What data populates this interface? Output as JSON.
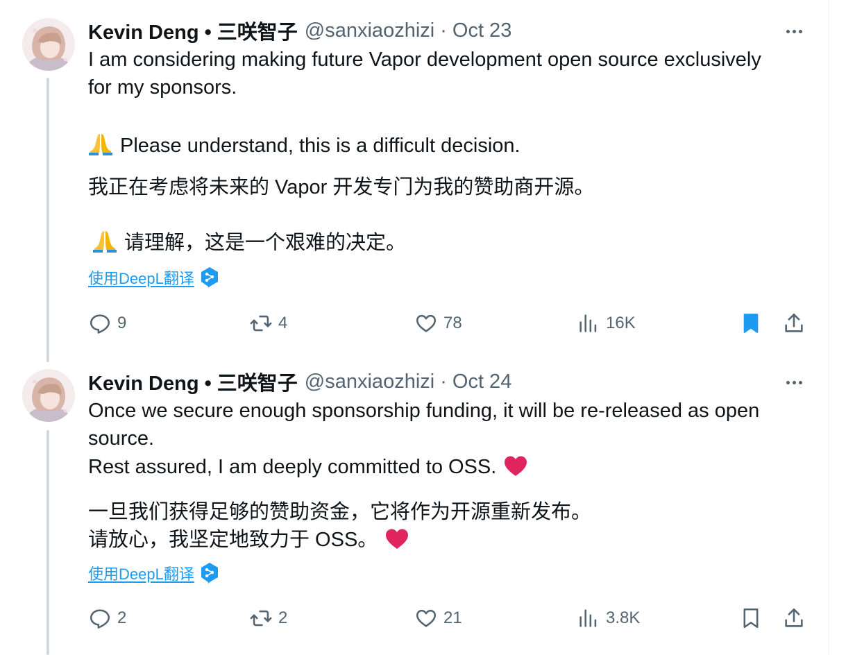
{
  "tweets": [
    {
      "author": {
        "name": "Kevin Deng • 三咲智子",
        "handle": "@sanxiaozhizi",
        "date": "Oct 23"
      },
      "lines": [
        "I am considering making future Vapor development open source exclusively",
        "for my sponsors.",
        "Please understand, this is a difficult decision.",
        "我正在考虑将未来的 Vapor 开发专门为我的赞助商开源。",
        "请理解，这是一个艰难的决定。"
      ],
      "emoji": "🙏",
      "translate_label": "使用DeepL翻译",
      "stats": {
        "replies": "9",
        "retweets": "4",
        "likes": "78",
        "views": "16K"
      },
      "bookmarked": true
    },
    {
      "author": {
        "name": "Kevin Deng • 三咲智子",
        "handle": "@sanxiaozhizi",
        "date": "Oct 24"
      },
      "lines": [
        "Once we secure enough sponsorship funding, it will be re-released as open",
        "source.",
        "Rest assured, I am deeply committed to OSS.",
        "一旦我们获得足够的赞助资金，它将作为开源重新发布。",
        "请放心，我坚定地致力于 OSS。"
      ],
      "emoji": "❤️",
      "translate_label": "使用DeepL翻译",
      "stats": {
        "replies": "2",
        "retweets": "2",
        "likes": "21",
        "views": "3.8K"
      },
      "bookmarked": false
    }
  ],
  "colors": {
    "text": "#0f1419",
    "secondary": "#536471",
    "accent": "#1d9bf0",
    "heart": "#e0245e",
    "thread_line": "#cfd9de"
  },
  "icons": [
    "more-icon",
    "reply-icon",
    "retweet-icon",
    "like-icon",
    "views-icon",
    "bookmark-icon",
    "share-icon",
    "deepl-icon",
    "pray-emoji-icon",
    "heart-emoji-icon"
  ]
}
